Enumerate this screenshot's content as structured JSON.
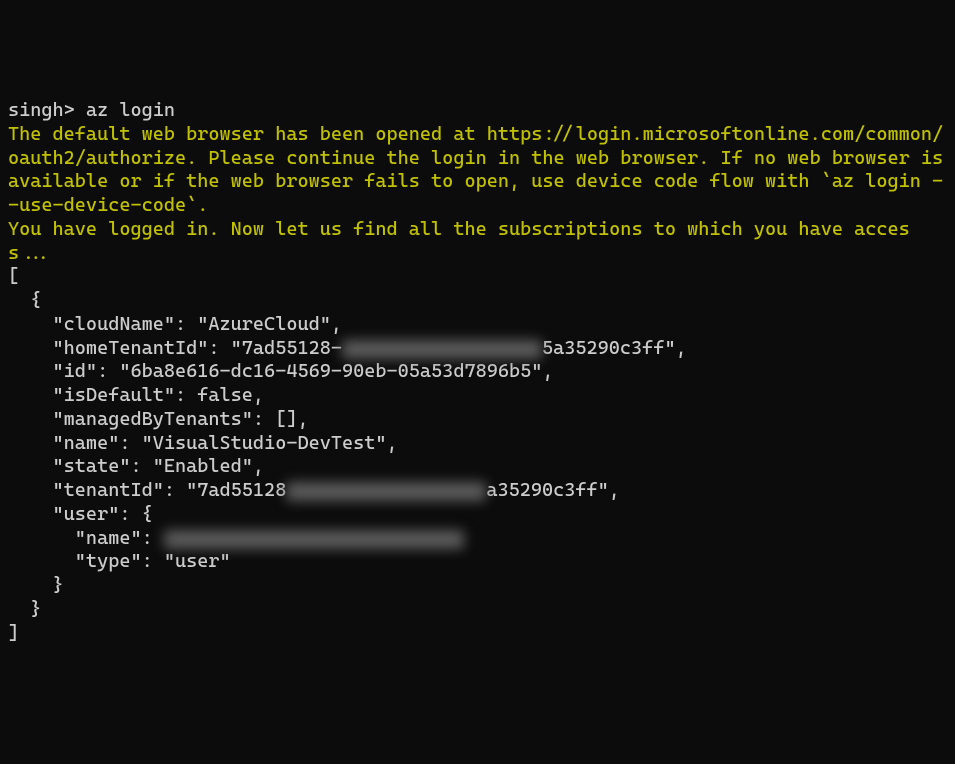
{
  "prompt": {
    "prefix": "singh>",
    "command": "az login"
  },
  "messages": {
    "browser_opened": "The default web browser has been opened at https://login.microsoftonline.com/common/oauth2/authorize. Please continue the login in the web browser. If no web browser is available or if the web browser fails to open, use device code flow with `az login --use-device-code`.",
    "logged_in": "You have logged in. Now let us find all the subscriptions to which you have access..."
  },
  "json_output": {
    "open_bracket": "[",
    "open_brace": "  {",
    "cloudName_line": "    \"cloudName\": \"AzureCloud\",",
    "homeTenantId_prefix": "    \"homeTenantId\": \"7ad55128-",
    "homeTenantId_suffix": "5a35290c3ff\",",
    "id_line": "    \"id\": \"6ba8e616-dc16-4569-90eb-05a53d7896b5\",",
    "isDefault_line": "    \"isDefault\": false,",
    "managedByTenants_line": "    \"managedByTenants\": [],",
    "name_line": "    \"name\": \"VisualStudio-DevTest\",",
    "state_line": "    \"state\": \"Enabled\",",
    "tenantId_prefix": "    \"tenantId\": \"7ad55128",
    "tenantId_suffix": "a35290c3ff\",",
    "user_open": "    \"user\": {",
    "user_name_prefix": "      \"name\": ",
    "user_type_line": "      \"type\": \"user\"",
    "user_close": "    }",
    "close_brace": "  }",
    "close_bracket": "]"
  }
}
